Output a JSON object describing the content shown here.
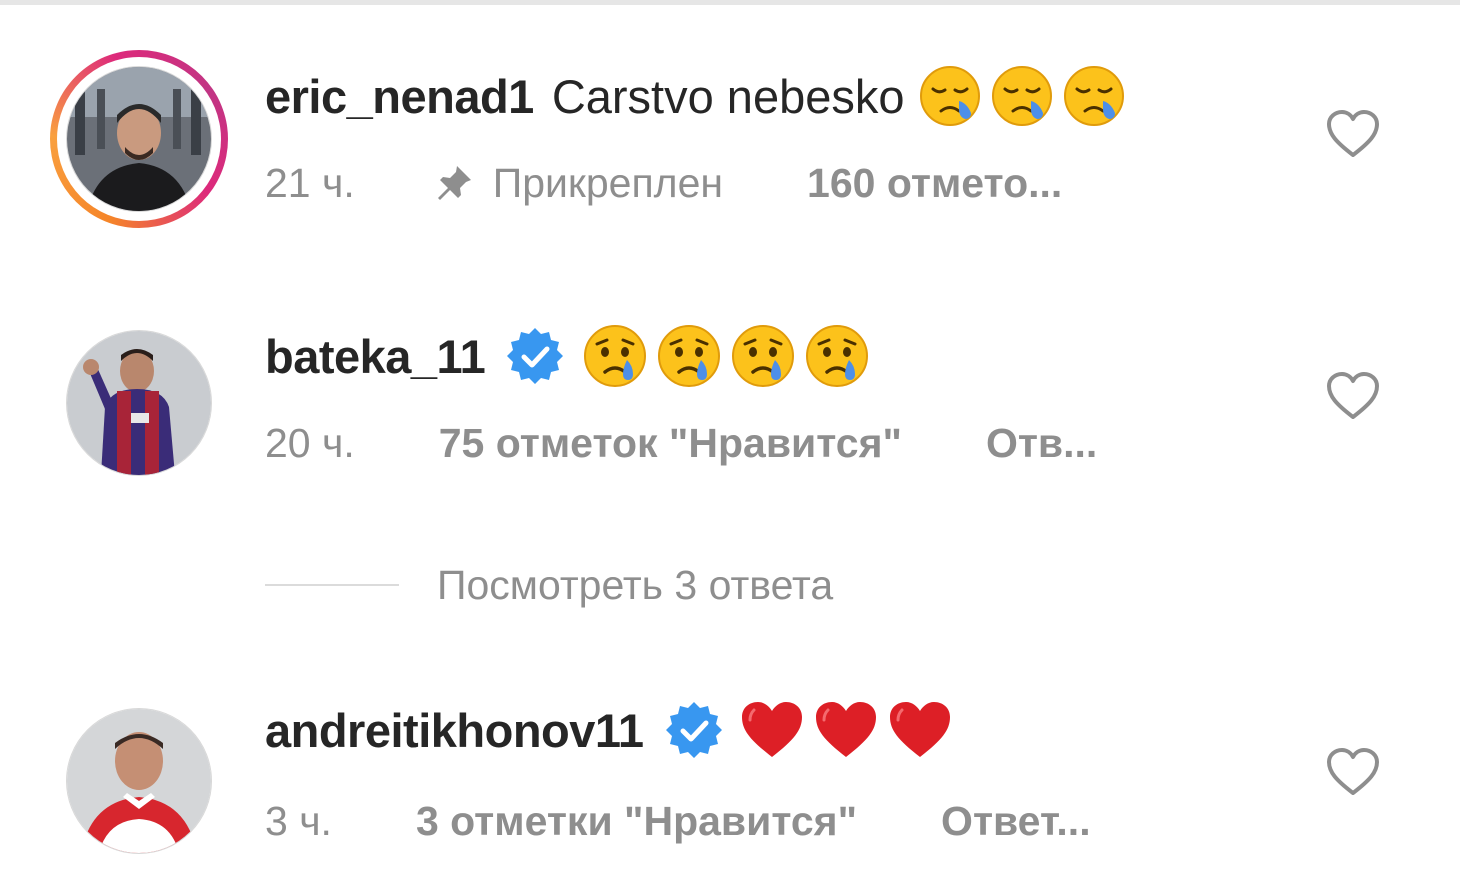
{
  "comments": [
    {
      "username": "eric_nenad1",
      "text": "Carstvo nebesko",
      "emojis": [
        "sad-crying-face-icon",
        "sad-crying-face-icon",
        "sad-crying-face-icon"
      ],
      "has_story_ring": true,
      "verified": false,
      "time": "21 ч.",
      "pinned_label": "Прикреплен",
      "likes": "160 отмето...",
      "liked": false
    },
    {
      "username": "bateka_11",
      "text": "",
      "emojis": [
        "crying-face-icon",
        "crying-face-icon",
        "crying-face-icon",
        "crying-face-icon"
      ],
      "has_story_ring": false,
      "verified": true,
      "time": "20 ч.",
      "likes": "75 отметок \"Нравится\"",
      "reply": "Отв...",
      "liked": false,
      "view_replies": "Посмотреть 3 ответа"
    },
    {
      "username": "andreitikhonov11",
      "text": "",
      "emojis": [
        "red-heart-icon",
        "red-heart-icon",
        "red-heart-icon"
      ],
      "has_story_ring": false,
      "verified": true,
      "time": "3 ч.",
      "likes": "3 отметки \"Нравится\"",
      "reply": "Ответ...",
      "liked": false
    }
  ],
  "colors": {
    "text": "#262626",
    "secondary": "#8e8e8e",
    "verified_blue": "#3897f0",
    "heart_red": "#dd1f26"
  }
}
